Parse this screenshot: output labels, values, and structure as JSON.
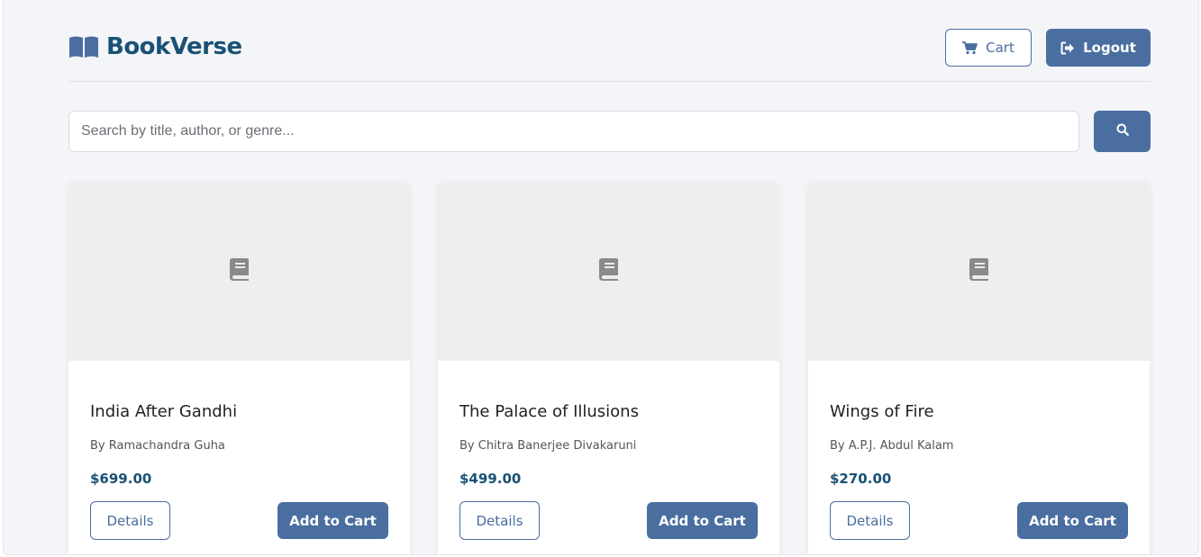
{
  "brand": {
    "name": "BookVerse",
    "icon": "open-book-icon"
  },
  "header": {
    "cart_label": "Cart",
    "cart_icon": "cart-icon",
    "logout_label": "Logout",
    "logout_icon": "sign-out-icon"
  },
  "search": {
    "placeholder": "Search by title, author, or genre...",
    "value": "",
    "button_icon": "search-icon"
  },
  "books": [
    {
      "title": "India After Gandhi",
      "author": "By Ramachandra Guha",
      "price": "$699.00",
      "details_label": "Details",
      "add_label": "Add to Cart",
      "cover_icon": "book-icon"
    },
    {
      "title": "The Palace of Illusions",
      "author": "By Chitra Banerjee Divakaruni",
      "price": "$499.00",
      "details_label": "Details",
      "add_label": "Add to Cart",
      "cover_icon": "book-icon"
    },
    {
      "title": "Wings of Fire",
      "author": "By A.P.J. Abdul Kalam",
      "price": "$270.00",
      "details_label": "Details",
      "add_label": "Add to Cart",
      "cover_icon": "book-icon"
    }
  ],
  "colors": {
    "primary": "#4a6ea0",
    "brand": "#1a5175",
    "background": "#f4f5f9",
    "cover_placeholder": "#eeeeee",
    "cover_icon": "#8a8a8a"
  }
}
